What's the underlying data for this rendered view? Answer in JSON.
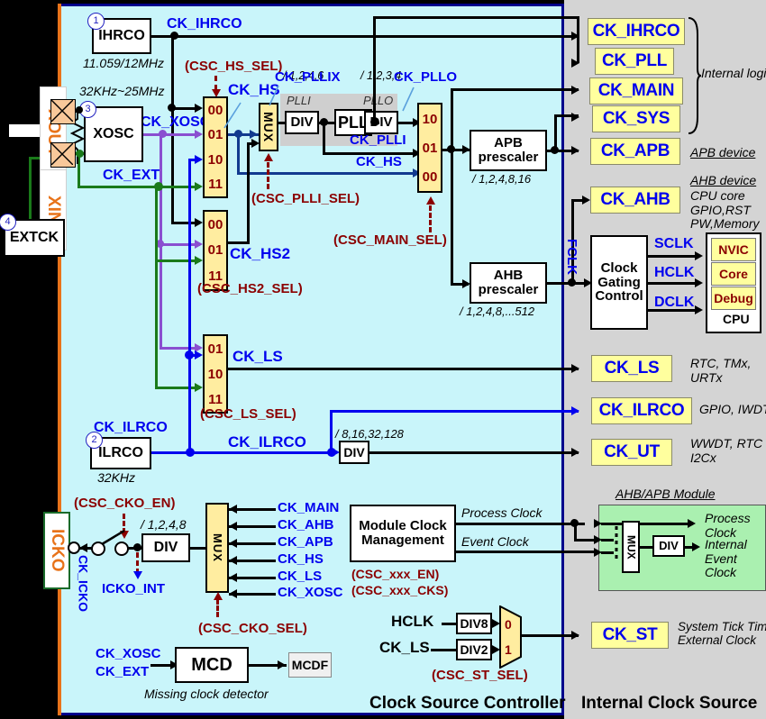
{
  "panels": {
    "csc_title": "Clock Source Controller",
    "ics_title": "Internal Clock Source"
  },
  "pads": {
    "xout": "XOUT",
    "xin": "XIN",
    "icko": "ICKO"
  },
  "sources": {
    "ihrco": {
      "name": "IHRCO",
      "num": "1",
      "freq": "11.059/12MHz",
      "out": "CK_IHRCO"
    },
    "xosc": {
      "name": "XOSC",
      "num": "3",
      "freq": "32KHz~25MHz",
      "out": "CK_XOSC"
    },
    "extck": {
      "name": "EXTCK",
      "num": "4",
      "out": "CK_EXT"
    },
    "ilrco": {
      "name": "ILRCO",
      "num": "2",
      "freq": "32KHz",
      "out": "CK_ILRCO"
    }
  },
  "muxes": {
    "hs": {
      "ctrl": "(CSC_HS_SEL)",
      "out": "CK_HS",
      "options": [
        "00",
        "01",
        "10",
        "11"
      ]
    },
    "hs2": {
      "ctrl": "(CSC_HS2_SEL)",
      "out": "CK_HS2",
      "options": [
        "00",
        "01",
        "11"
      ]
    },
    "ls": {
      "ctrl": "(CSC_LS_SEL)",
      "out": "CK_LS",
      "options": [
        "01",
        "10",
        "11"
      ]
    },
    "plli": {
      "ctrl": "(CSC_PLLI_SEL)",
      "label": "MUX"
    },
    "main": {
      "ctrl": "(CSC_MAIN_SEL)",
      "options": [
        "10",
        "01",
        "00"
      ],
      "in_labels": [
        "CK_PLLI",
        "CK_HS"
      ]
    },
    "cko": {
      "ctrl": "(CSC_CKO_SEL)",
      "label": "MUX",
      "inputs": [
        "CK_MAIN",
        "CK_AHB",
        "CK_APB",
        "CK_HS",
        "CK_LS",
        "CK_XOSC"
      ]
    },
    "st": {
      "ctrl": "(CSC_ST_SEL)",
      "options": [
        "0",
        "1"
      ]
    }
  },
  "pll": {
    "plli_label": "PLLI",
    "pllo_label": "PLLO",
    "plli_div": "/ 1,2,4,6",
    "pllo_div": "/ 1,2,3,4",
    "div": "DIV",
    "pll": "PLL",
    "ck_pllix": "CK_PLLIX",
    "ck_pllo": "CK_PLLO",
    "ck_plli": "CK_PLLI",
    "ck_hs": "CK_HS"
  },
  "prescalers": {
    "apb": {
      "name": "APB\nprescaler",
      "ratio": "/ 1,2,4,8,16"
    },
    "ahb": {
      "name": "AHB\nprescaler",
      "ratio": "/ 1,2,4,8,...512"
    },
    "ut_div": {
      "name": "DIV",
      "ratio": "/ 8,16,32,128"
    },
    "cko_div": {
      "name": "DIV",
      "ratio": "/ 1,2,4,8"
    }
  },
  "icko": {
    "enable_ctrl": "(CSC_CKO_EN)",
    "ck_icko": "CK_ICKO",
    "icko_int": "ICKO_INT"
  },
  "mcd": {
    "block": "MCD",
    "flag": "MCDF",
    "caption": "Missing clock detector",
    "inputs": [
      "CK_XOSC",
      "CK_EXT"
    ]
  },
  "mcm": {
    "title": "Module Clock\nManagement",
    "ctrl1": "(CSC_xxx_EN)",
    "ctrl2": "(CSC_xxx_CKS)",
    "process_clock": "Process Clock",
    "event_clock": "Event Clock"
  },
  "systick": {
    "hclk": "HCLK",
    "ck_ls": "CK_LS",
    "div8": "DIV8",
    "div2": "DIV2"
  },
  "outputs": [
    {
      "label": "CK_IHRCO",
      "note": ""
    },
    {
      "label": "CK_PLL",
      "note": ""
    },
    {
      "label": "CK_MAIN",
      "note": ""
    },
    {
      "label": "CK_SYS",
      "note": ""
    },
    {
      "label": "CK_APB",
      "note": "APB device"
    },
    {
      "label": "CK_AHB",
      "note": "AHB device"
    },
    {
      "label": "CK_LS",
      "note": "RTC, TMx,\nURTx"
    },
    {
      "label": "CK_ILRCO",
      "note": "GPIO, IWDT"
    },
    {
      "label": "CK_UT",
      "note": "WWDT, RTC\nI2Cx"
    },
    {
      "label": "CK_ST",
      "note": "System Tick Timer\nExternal Clock"
    }
  ],
  "notes": {
    "internal_logic": "Internal logic",
    "apb_device": "APB device",
    "ahb_device": "AHB device",
    "ahb_device_list": "CPU core\nGPIO,RST\nPW,Memory",
    "ck_ls_note": "RTC, TMx,\nURTx",
    "ck_ilrco_note": "GPIO, IWDT",
    "ck_ut_note": "WWDT, RTC\nI2Cx",
    "ck_st_note": "System Tick Timer\nExternal Clock",
    "ahbapb_module": "AHB/APB Module",
    "process_clock": "Process\nClock",
    "internal_event_clock": "Internal\nEvent\nClock"
  },
  "cpu": {
    "gating": "Clock\nGating\nControl",
    "fclk": "FCLK",
    "sclk": "SCLK",
    "hclk": "HCLK",
    "dclk": "DCLK",
    "items": [
      "NVIC",
      "Core",
      "Debug"
    ],
    "title": "CPU"
  },
  "div_label": "DIV",
  "mux_label": "MUX"
}
